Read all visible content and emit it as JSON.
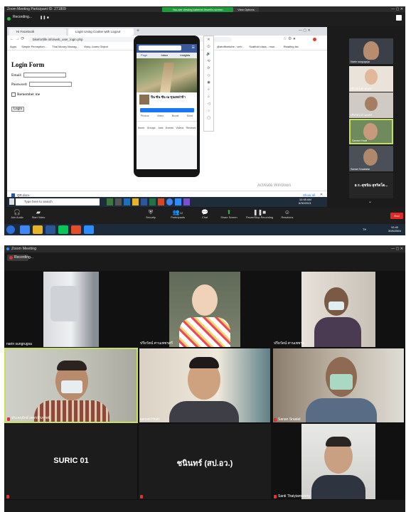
{
  "top": {
    "zoom_title": "Zoom Meeting Participant ID: 271809",
    "banner": "You are viewing kalmnet ilmmtt's screen",
    "view_options": "View Options",
    "recording": "Recording...",
    "browser": {
      "tabs": [
        "Hi Facebook",
        "Login Using Cookie with Logout"
      ],
      "url": "bikefortlife.info/web_user_login.php",
      "bookmarks": [
        "Apps",
        "Simple Perception...",
        "Thai Money Manag...",
        "Vicky Jones Object",
        "@atoffinetube - veh...",
        "Scaffold class - mun...",
        "Reading list"
      ],
      "form_title": "Login Form",
      "email_label": "Email:",
      "password_label": "Password:",
      "remember_label": "Remember me",
      "login_label": "Login",
      "status_file": "QR.docx",
      "show_all": "Show all",
      "activate_title": "Activate Windows",
      "activate_sub": "Go to Settings to activate Windows.",
      "taskbar_search": "Type here to search",
      "clock_time": "10:45 AM",
      "clock_date": "6/30/2021"
    },
    "phone": {
      "profile_name": "ปีน ซัน ซัน ณ ขุนเหล่าข้า",
      "profile_sub": "",
      "tabs": [
        "Page",
        "Inbox",
        "Insights"
      ],
      "actions": [
        "Photos",
        "Video",
        "Boost",
        "More"
      ],
      "nav": [
        "Home",
        "Groups",
        "Jobs",
        "Events",
        "Videos",
        "Reviews"
      ]
    },
    "controls": {
      "join_audio": "Join Audio",
      "start_video": "Start Video",
      "security": "Security",
      "participants": "Participants",
      "participants_count": "12",
      "chat": "Chat",
      "share_screen": "Share Screen",
      "pause_recording": "Pause/Stop Recording",
      "reactions": "Reactions",
      "end": "End",
      "win_time": "10:45",
      "win_date": "30/6/2564",
      "win_lang": "TH"
    },
    "right_tiles": [
      "Narin surgugoja",
      "ปรียวัตน์ ศานเพชร",
      "ปรียวัตน์ ศานเพชร",
      "Sanset Hrutt",
      "Sanan Sraalalar",
      "ธ.ร.-สุชนิน สุจริตโต..."
    ]
  },
  "bottom": {
    "zoom_title": "Zoom Meeting",
    "recording": "Recording...",
    "grid": [
      {
        "name": "narin sungrugsa",
        "label": ""
      },
      {
        "name": "ปรียวัตน์ ศานเพชรศรี",
        "label": ""
      },
      {
        "name": "ปรียวัตน์ ศานเพชรธ..",
        "label": ""
      },
      {
        "name": "ประครุจักษ์ เพชรธีรภาพย์",
        "label": ""
      },
      {
        "name": "sanset Hrutt",
        "label": ""
      },
      {
        "name": "Sanan Sraalat",
        "label": ""
      },
      {
        "name": "",
        "label": "SURIC 01"
      },
      {
        "name": "",
        "label": "ชนินทร์ (สป.อว.)"
      },
      {
        "name": "Santi Thaiyiamwong",
        "label": ""
      }
    ]
  }
}
